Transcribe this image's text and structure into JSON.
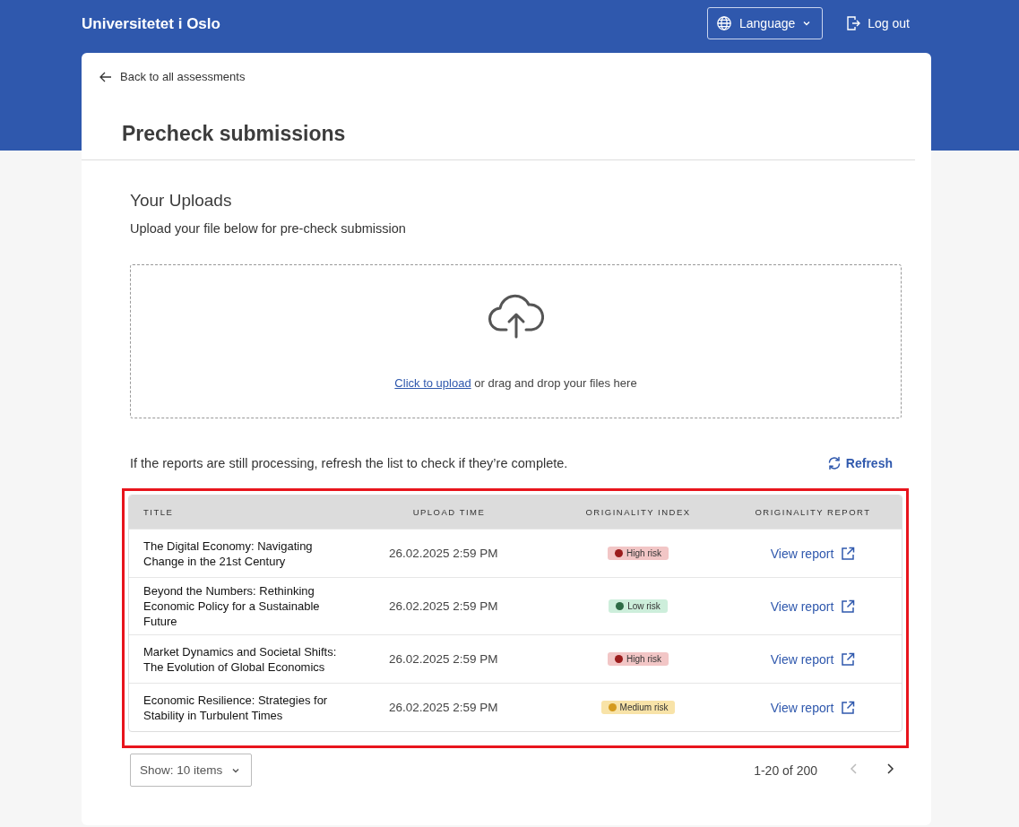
{
  "header": {
    "brand": "Universitetet i Oslo",
    "language": "Language",
    "logout": "Log out"
  },
  "back_link": "Back to all assessments",
  "page_title": "Precheck submissions",
  "uploads": {
    "heading": "Your Uploads",
    "subtitle": "Upload your file below for pre-check submission",
    "upload_link": "Click to upload",
    "upload_rest": " or drag and drop your files here"
  },
  "refresh_note": "If the reports are still processing, refresh the list to check if they’re complete.",
  "refresh_button": "Refresh",
  "table": {
    "highlighted": true,
    "columns": [
      "TITLE",
      "UPLOAD TIME",
      "ORIGINALITY INDEX",
      "ORIGINALITY REPORT"
    ],
    "rows": [
      {
        "title": "The Digital Economy: Navigating Change in the 21st Century",
        "time": "26.02.2025 2:59 PM",
        "risk": {
          "label": "High risk",
          "kind": "high"
        },
        "report": "View report"
      },
      {
        "title": "Beyond the Numbers: Rethinking Economic Policy for a Sustainable Future",
        "time": "26.02.2025 2:59 PM",
        "risk": {
          "label": "Low risk",
          "kind": "low"
        },
        "report": "View report"
      },
      {
        "title": "Market Dynamics and Societal Shifts: The Evolution of Global Economics",
        "time": "26.02.2025 2:59 PM",
        "risk": {
          "label": "High risk",
          "kind": "high"
        },
        "report": "View report"
      },
      {
        "title": "Economic Resilience: Strategies for Stability in Turbulent Times",
        "time": "26.02.2025 2:59 PM",
        "risk": {
          "label": "Medium risk",
          "kind": "medium"
        },
        "report": "View report"
      }
    ]
  },
  "pagination": {
    "page_size": "Show: 10 items",
    "range": "1-20 of 200",
    "prev_disabled": true,
    "next_disabled": false
  }
}
